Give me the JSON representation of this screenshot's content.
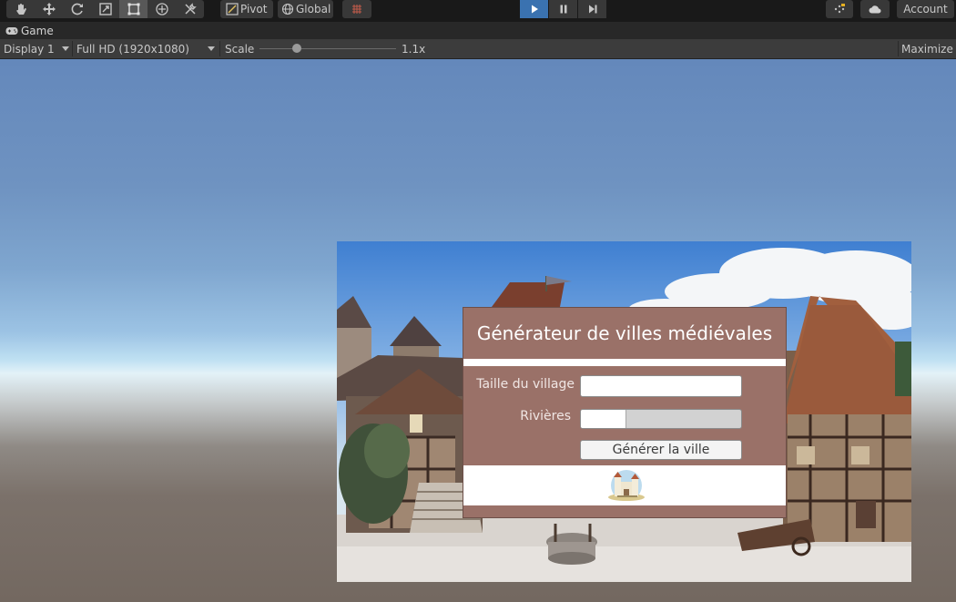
{
  "toolbar": {
    "tools": [
      "hand-tool",
      "move-tool",
      "rotate-tool",
      "scale-tool",
      "rect-tool",
      "transform-tool",
      "custom-tool"
    ],
    "active_tool": "rect-tool",
    "pivot_label": "Pivot",
    "global_label": "Global",
    "playback": {
      "play": "play-icon",
      "pause": "pause-icon",
      "step": "step-icon",
      "playing": true
    },
    "account_label": "Account",
    "accent_color": "#3a72b0"
  },
  "tab": {
    "label": "Game"
  },
  "gamebar": {
    "display": "Display 1",
    "resolution": "Full HD (1920x1080)",
    "scale_label": "Scale",
    "scale_value": "1.1x",
    "maximize_label": "Maximize On Play"
  },
  "dialog": {
    "title": "Générateur de villes médiévales",
    "village_size_label": "Taille du village",
    "village_size_value": "",
    "rivers_label": "Rivières",
    "rivers_value": 0.28,
    "generate_button": "Générer la ville",
    "logo_icon": "castle-logo-icon",
    "panel_color": "#9a7168"
  }
}
